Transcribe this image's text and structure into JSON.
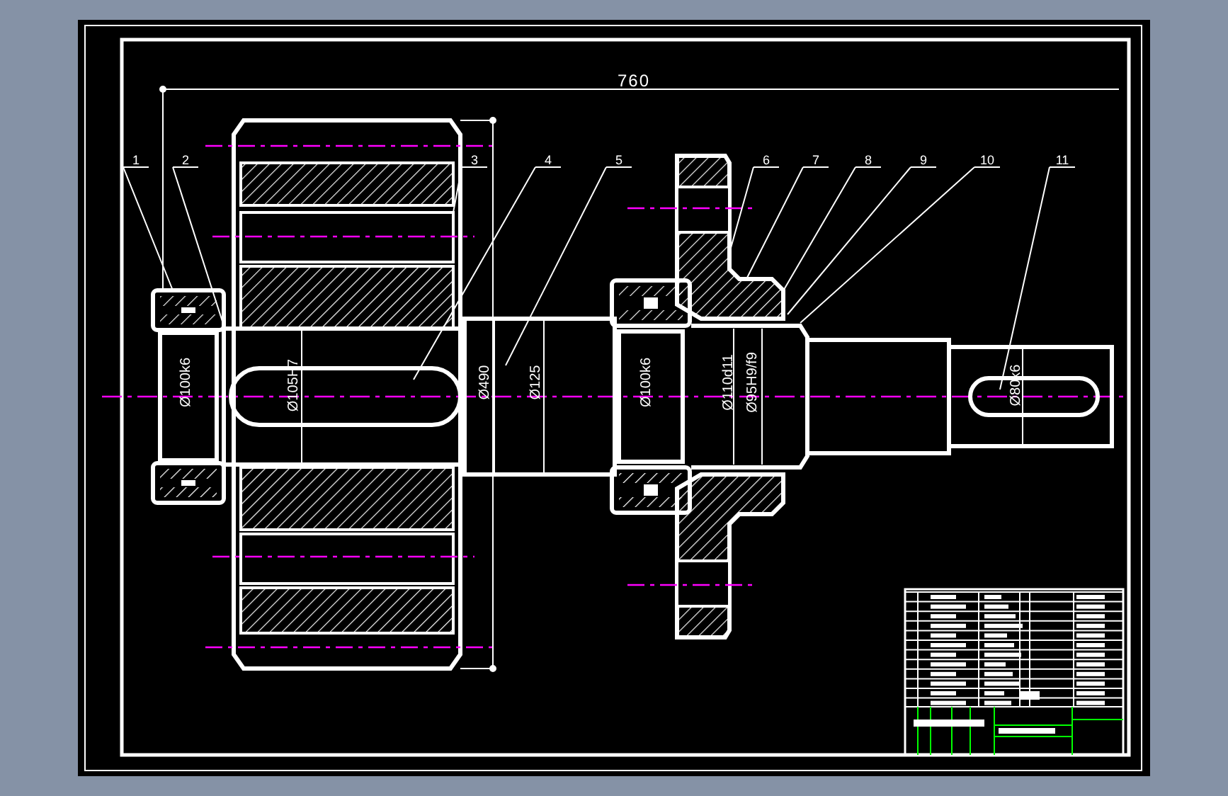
{
  "drawing": {
    "overall_dimension": "760",
    "balloons": [
      {
        "label": "1"
      },
      {
        "label": "2"
      },
      {
        "label": "3"
      },
      {
        "label": "4"
      },
      {
        "label": "5"
      },
      {
        "label": "6"
      },
      {
        "label": "7"
      },
      {
        "label": "8"
      },
      {
        "label": "9"
      },
      {
        "label": "10"
      },
      {
        "label": "11"
      }
    ],
    "diameters": [
      {
        "text": "Ø100k6"
      },
      {
        "text": "Ø105H7"
      },
      {
        "text": "Ø490"
      },
      {
        "text": "Ø125"
      },
      {
        "text": "Ø100k6"
      },
      {
        "text": "Ø110d11"
      },
      {
        "text": "Ø95H9/f9"
      },
      {
        "text": "Ø80k6"
      }
    ]
  }
}
